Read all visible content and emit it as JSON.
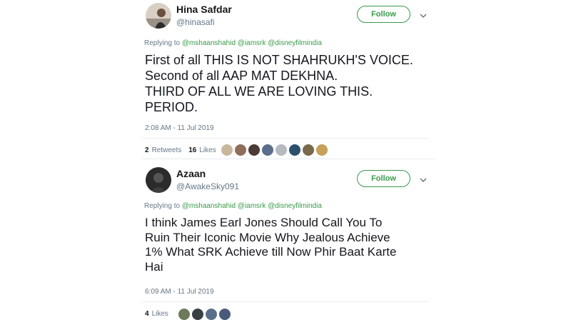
{
  "tweets": [
    {
      "name": "Hina Safdar",
      "handle": "@hinasafi",
      "follow_label": "Follow",
      "reply_prefix": "Replying to",
      "reply_to": "@mshaanshahid @iamsrk @disneyfilmindia",
      "text": "First of all THIS IS NOT SHAHRUKH'S VOICE.\nSecond of all AAP MAT DEKHNA.\nTHIRD OF ALL WE ARE LOVING THIS.\nPERIOD.",
      "time": "2:08 AM - 11 Jul 2019",
      "retweets_count": "2",
      "retweets_label": "Retweets",
      "likes_count": "16",
      "likes_label": "Likes",
      "liker_colors": [
        "#c9b79c",
        "#8e6e5a",
        "#4a3b36",
        "#5a6f8a",
        "#b5b9c0",
        "#2d4f6e",
        "#7a6a4a",
        "#c7a05a"
      ]
    },
    {
      "name": "Azaan",
      "handle": "@AwakeSky091",
      "follow_label": "Follow",
      "reply_prefix": "Replying to",
      "reply_to": "@mshaanshahid @iamsrk @disneyfilmindia",
      "text": "I think James Earl Jones Should Call You To\nRuin Their Iconic Movie Why Jealous Achieve\n1% What SRK Achieve till Now Phir Baat Karte\nHai",
      "time": "6:09 AM - 11 Jul 2019",
      "likes_count": "4",
      "likes_label": "Likes",
      "liker_colors": [
        "#6a7a5a",
        "#3a3f44",
        "#5a6f8a",
        "#4a5a7a"
      ]
    }
  ],
  "colors": {
    "accent": "#3a9a4a",
    "muted": "#657786",
    "text": "#14171a"
  }
}
